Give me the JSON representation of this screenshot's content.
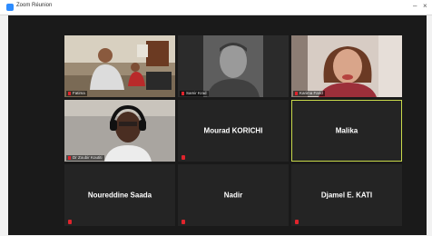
{
  "window": {
    "title": "Zoom Réunion"
  },
  "participants": [
    {
      "name": "Fatima",
      "video": true
    },
    {
      "name": "Samir Krad",
      "video": true
    },
    {
      "name": "Karima Farid",
      "video": true
    },
    {
      "name": "Dr Zoubir Koutiti",
      "video": true
    },
    {
      "name": "Mourad KORICHI",
      "video": false
    },
    {
      "name": "Malika",
      "video": false,
      "active_speaker": true
    },
    {
      "name": "Noureddine Saada",
      "video": false
    },
    {
      "name": "Nadir",
      "video": false
    },
    {
      "name": "Djamel E. KATI",
      "video": false
    }
  ],
  "colors": {
    "active_border": "#c8d94a",
    "mic_muted": "#e0242c",
    "tile_bg": "#242424"
  }
}
